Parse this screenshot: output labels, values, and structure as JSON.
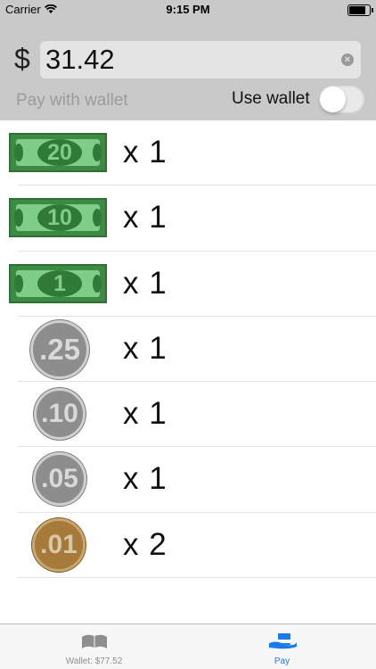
{
  "status_bar": {
    "carrier": "Carrier",
    "time": "9:15 PM"
  },
  "header": {
    "currency_symbol": "$",
    "amount": "31.42",
    "pay_with_wallet": "Pay with wallet",
    "use_wallet": "Use wallet",
    "use_wallet_on": false
  },
  "items": [
    {
      "kind": "bill",
      "denomination": "20",
      "quantity": "x 1"
    },
    {
      "kind": "bill",
      "denomination": "10",
      "quantity": "x 1"
    },
    {
      "kind": "bill",
      "denomination": "1",
      "quantity": "x 1"
    },
    {
      "kind": "coin",
      "denomination": ".25",
      "quantity": "x 1",
      "color": "silver"
    },
    {
      "kind": "coin",
      "denomination": ".10",
      "quantity": "x 1",
      "color": "silver"
    },
    {
      "kind": "coin",
      "denomination": ".05",
      "quantity": "x 1",
      "color": "silver"
    },
    {
      "kind": "coin",
      "denomination": ".01",
      "quantity": "x 2",
      "color": "copper"
    }
  ],
  "tabbar": {
    "wallet_label": "Wallet: $77.52",
    "wallet_icon": "wallet-icon",
    "pay_label": "Pay",
    "pay_icon": "pay-hand-icon",
    "active_color": "#1a7be8",
    "inactive_color": "#8e8e8e"
  }
}
